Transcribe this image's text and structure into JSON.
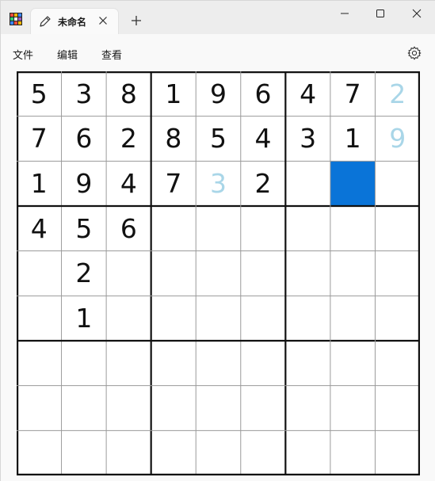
{
  "tab": {
    "title": "未命名"
  },
  "menu": {
    "items": [
      "文件",
      "编辑",
      "查看"
    ]
  },
  "icons": {
    "app": "sudoku-grid-icon",
    "tab_edit": "pencil-icon",
    "tab_close": "close-icon",
    "new_tab": "plus-icon",
    "minimize": "minimize-icon",
    "maximize": "maximize-icon",
    "close": "close-icon",
    "settings": "gear-icon"
  },
  "colors": {
    "given_digit": "#111111",
    "pencil_digit": "#a9d6e8",
    "selection": "#0a74d8"
  },
  "board": {
    "selected": [
      2,
      7
    ],
    "pencil_cells": [
      [
        0,
        8
      ],
      [
        1,
        8
      ],
      [
        2,
        4
      ]
    ],
    "cells": [
      [
        "5",
        "3",
        "8",
        "1",
        "9",
        "6",
        "4",
        "7",
        "2"
      ],
      [
        "7",
        "6",
        "2",
        "8",
        "5",
        "4",
        "3",
        "1",
        "9"
      ],
      [
        "1",
        "9",
        "4",
        "7",
        "3",
        "2",
        "",
        "",
        ""
      ],
      [
        "4",
        "5",
        "6",
        "",
        "",
        "",
        "",
        "",
        ""
      ],
      [
        "",
        "2",
        "",
        "",
        "",
        "",
        "",
        "",
        ""
      ],
      [
        "",
        "1",
        "",
        "",
        "",
        "",
        "",
        "",
        ""
      ],
      [
        "",
        "",
        "",
        "",
        "",
        "",
        "",
        "",
        ""
      ],
      [
        "",
        "",
        "",
        "",
        "",
        "",
        "",
        "",
        ""
      ],
      [
        "",
        "",
        "",
        "",
        "",
        "",
        "",
        "",
        ""
      ]
    ]
  }
}
